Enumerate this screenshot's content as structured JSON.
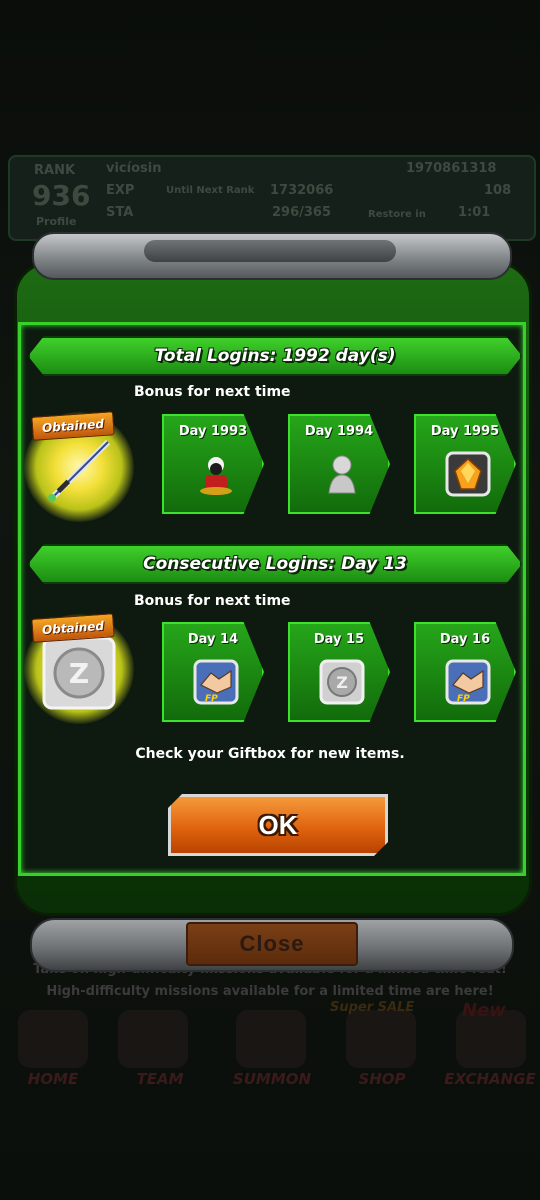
{
  "background": {
    "status": {
      "rank_label": "RANK",
      "rank_value": "936",
      "player_name": "vicíosin",
      "exp_label": "EXP",
      "until_next_label": "Until Next Rank",
      "exp_value": "1732066",
      "sta_label": "STA",
      "sta_value": "296/365",
      "profile_label": "Profile",
      "zeni_value": "1970861318",
      "stones_value": "108",
      "restore_label": "Restore in",
      "restore_value": "1:01"
    },
    "ticker_1": "Take on high-difficulty missions available for a limited time feat!",
    "ticker_2": "High-difficulty missions available for a limited time are here!",
    "sale_badge": "Super SALE",
    "new_badge": "New",
    "nav": [
      "HOME",
      "TEAM",
      "SUMMON",
      "SHOP",
      "EXCHANGE"
    ],
    "close_label": "Close"
  },
  "popup": {
    "total": {
      "header": "Total Logins: 1992 day(s)",
      "bonus_label": "Bonus for next time",
      "obtained_label": "Obtained",
      "days": [
        {
          "label": "Day 1993",
          "icon": "genie-character-icon"
        },
        {
          "label": "Day 1994",
          "icon": "silver-statue-icon"
        },
        {
          "label": "Day 1995",
          "icon": "orange-crystal-icon"
        }
      ]
    },
    "consecutive": {
      "header": "Consecutive Logins: Day 13",
      "bonus_label": "Bonus for next time",
      "obtained_label": "Obtained",
      "days": [
        {
          "label": "Day 14",
          "icon": "friend-points-handshake-icon"
        },
        {
          "label": "Day 15",
          "icon": "silver-z-medal-icon"
        },
        {
          "label": "Day 16",
          "icon": "friend-points-handshake-icon"
        }
      ]
    },
    "message": "Check your Giftbox for new items.",
    "ok_label": "OK",
    "colors": {
      "panel_border": "#38d12b",
      "ok_button": "#e0640f",
      "obtained_glow": "#f4e03a"
    }
  }
}
